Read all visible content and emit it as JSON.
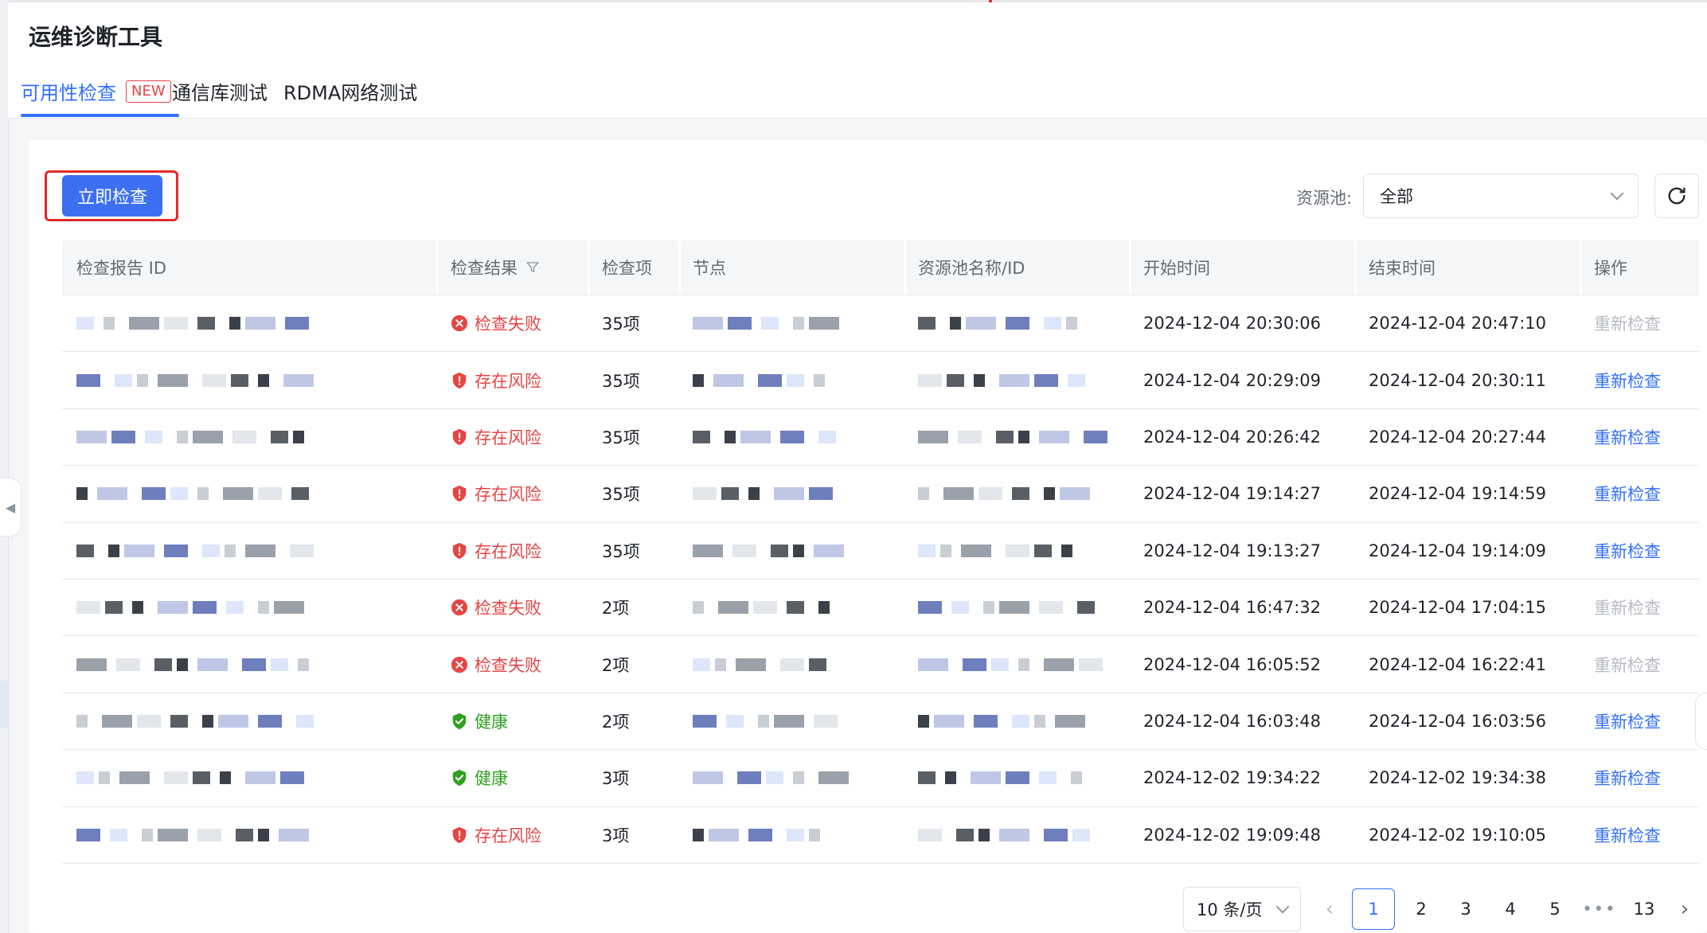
{
  "app": {
    "title": "运维诊断工具"
  },
  "tabs": [
    {
      "label": "可用性检查",
      "badge": "NEW",
      "active": true
    },
    {
      "label": "通信库测试",
      "active": false
    },
    {
      "label": "RDMA网络测试",
      "active": false
    }
  ],
  "toolbar": {
    "check_now_label": "立即检查",
    "pool_label": "资源池:",
    "pool_value": "全部"
  },
  "table": {
    "columns": [
      "检查报告 ID",
      "检查结果",
      "检查项",
      "节点",
      "资源池名称/ID",
      "开始时间",
      "结束时间",
      "操作"
    ],
    "rows": [
      {
        "result": "检查失败",
        "status": "fail",
        "items": "35项",
        "start": "2024-12-04 20:30:06",
        "end": "2024-12-04 20:47:10",
        "action": "重新检查",
        "action_enabled": false
      },
      {
        "result": "存在风险",
        "status": "risk",
        "items": "35项",
        "start": "2024-12-04 20:29:09",
        "end": "2024-12-04 20:30:11",
        "action": "重新检查",
        "action_enabled": true
      },
      {
        "result": "存在风险",
        "status": "risk",
        "items": "35项",
        "start": "2024-12-04 20:26:42",
        "end": "2024-12-04 20:27:44",
        "action": "重新检查",
        "action_enabled": true
      },
      {
        "result": "存在风险",
        "status": "risk",
        "items": "35项",
        "start": "2024-12-04 19:14:27",
        "end": "2024-12-04 19:14:59",
        "action": "重新检查",
        "action_enabled": true
      },
      {
        "result": "存在风险",
        "status": "risk",
        "items": "35项",
        "start": "2024-12-04 19:13:27",
        "end": "2024-12-04 19:14:09",
        "action": "重新检查",
        "action_enabled": true
      },
      {
        "result": "检查失败",
        "status": "fail",
        "items": "2项",
        "start": "2024-12-04 16:47:32",
        "end": "2024-12-04 17:04:15",
        "action": "重新检查",
        "action_enabled": false
      },
      {
        "result": "检查失败",
        "status": "fail",
        "items": "2项",
        "start": "2024-12-04 16:05:52",
        "end": "2024-12-04 16:22:41",
        "action": "重新检查",
        "action_enabled": false
      },
      {
        "result": "健康",
        "status": "ok",
        "items": "2项",
        "start": "2024-12-04 16:03:48",
        "end": "2024-12-04 16:03:56",
        "action": "重新检查",
        "action_enabled": true
      },
      {
        "result": "健康",
        "status": "ok",
        "items": "3项",
        "start": "2024-12-02 19:34:22",
        "end": "2024-12-02 19:34:38",
        "action": "重新检查",
        "action_enabled": true
      },
      {
        "result": "存在风险",
        "status": "risk",
        "items": "3项",
        "start": "2024-12-02 19:09:48",
        "end": "2024-12-02 19:10:05",
        "action": "重新检查",
        "action_enabled": true
      }
    ]
  },
  "pagination": {
    "page_size": "10 条/页",
    "pages": [
      "1",
      "2",
      "3",
      "4",
      "5",
      "•••",
      "13"
    ],
    "current": "1"
  },
  "colors": {
    "accent": "#3370ff",
    "danger": "#e54545",
    "success": "#2ea121",
    "disabled": "#b7bbc2"
  },
  "icons": {
    "fail": "x-circle-icon",
    "risk": "shield-alert-icon",
    "ok": "shield-check-icon",
    "filter": "filter-icon",
    "refresh": "refresh-icon"
  }
}
